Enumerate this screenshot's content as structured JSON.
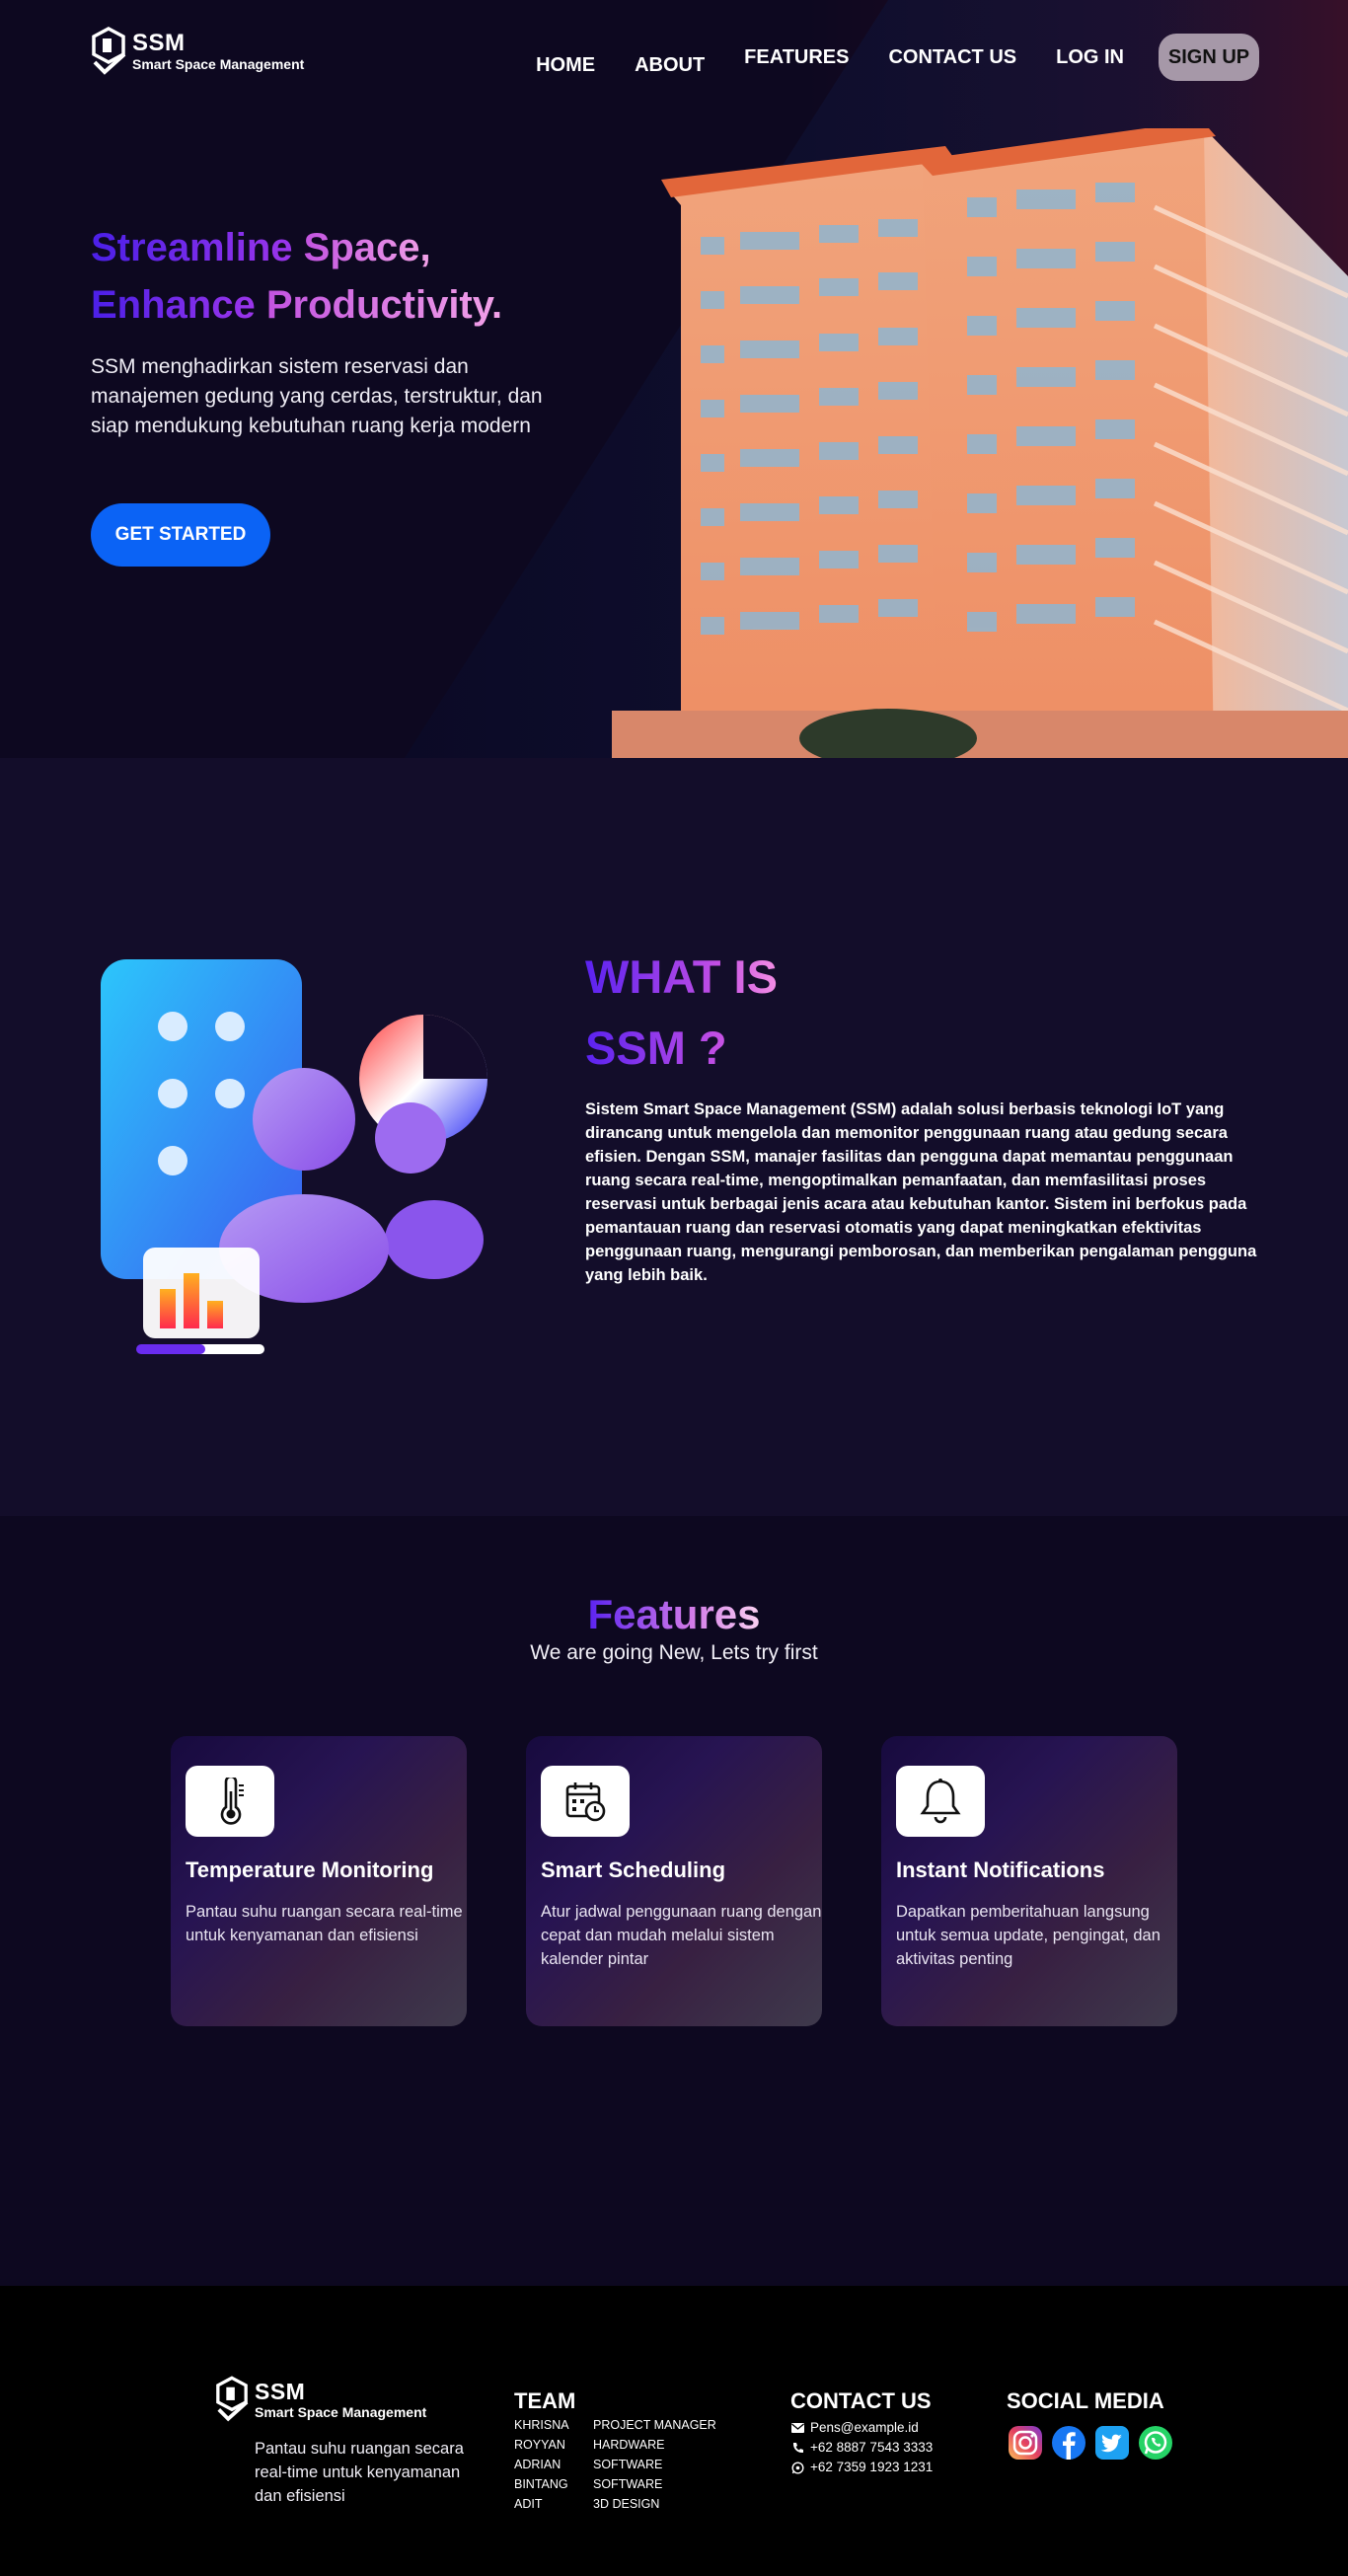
{
  "brand": {
    "name": "SSM",
    "tagline": "Smart Space Management"
  },
  "nav": {
    "home": "HOME",
    "about": "ABOUT",
    "features": "FEATURES",
    "contact": "CONTACT US",
    "login": "LOG IN",
    "signup": "SIGN UP"
  },
  "hero": {
    "title_l1_a": "Streamline",
    "title_l1_b": "Space,",
    "title_l2_a": "Enhance",
    "title_l2_b": "Productivity.",
    "description": "SSM menghadirkan sistem reservasi dan manajemen gedung yang cerdas, terstruktur, dan siap mendukung kebutuhan ruang kerja modern",
    "cta": "GET STARTED"
  },
  "what": {
    "title_l1": "WHAT IS",
    "title_l2": "SSM ?",
    "body": "Sistem Smart Space Management (SSM) adalah solusi berbasis teknologi IoT yang dirancang untuk mengelola dan memonitor penggunaan ruang atau gedung secara efisien. Dengan SSM, manajer fasilitas dan pengguna dapat memantau penggunaan ruang secara real-time, mengoptimalkan pemanfaatan, dan memfasilitasi proses reservasi untuk berbagai jenis acara atau kebutuhan kantor. Sistem ini berfokus pada pemantauan ruang dan reservasi otomatis yang dapat meningkatkan efektivitas penggunaan ruang, mengurangi pemborosan, dan memberikan pengalaman pengguna yang lebih baik."
  },
  "features": {
    "title": "Features",
    "subtitle": "We are going New, Lets try first",
    "cards": [
      {
        "icon": "thermometer-icon",
        "title": "Temperature Monitoring",
        "desc": "Pantau suhu ruangan secara real-time untuk kenyamanan dan efisiensi"
      },
      {
        "icon": "calendar-clock-icon",
        "title": "Smart Scheduling",
        "desc": "Atur jadwal penggunaan ruang dengan cepat dan mudah melalui sistem kalender pintar"
      },
      {
        "icon": "bell-icon",
        "title": "Instant Notifications",
        "desc": "Dapatkan pemberitahuan langsung untuk semua update, pengingat, dan aktivitas penting"
      }
    ]
  },
  "footer": {
    "description": "Pantau suhu ruangan secara real-time untuk kenyamanan dan efisiensi",
    "team_title": "TEAM",
    "team": [
      {
        "name": "KHRISNA",
        "role": "PROJECT MANAGER"
      },
      {
        "name": "ROYYAN",
        "role": "HARDWARE"
      },
      {
        "name": "ADRIAN",
        "role": "SOFTWARE"
      },
      {
        "name": "BINTANG",
        "role": "SOFTWARE"
      },
      {
        "name": "ADIT",
        "role": "3D DESIGN"
      }
    ],
    "contact_title": "CONTACT US",
    "email": "Pens@example.id",
    "phone": "+62 8887 7543 3333",
    "whatsapp": "+62 7359 1923 1231",
    "social_title": "SOCIAL MEDIA",
    "social": [
      "instagram-icon",
      "facebook-icon",
      "twitter-icon",
      "whatsapp-icon"
    ]
  },
  "colors": {
    "primary": "#0b63f5",
    "background": "#0f0a24",
    "accent_purple": "#5a22f0",
    "accent_pink": "#f3a2e8"
  }
}
